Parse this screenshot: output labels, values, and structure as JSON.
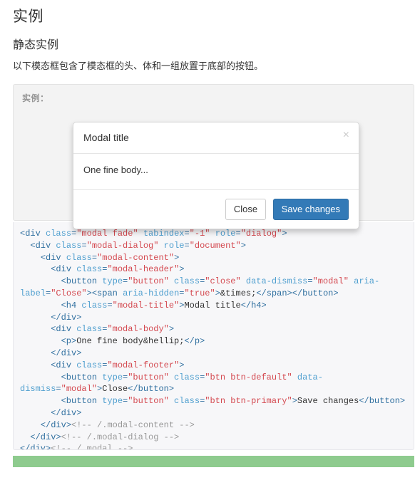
{
  "page": {
    "title": "实例",
    "section_heading": "静态实例",
    "description": "以下模态框包含了模态框的头、体和一组放置于底部的按钮。"
  },
  "example_box": {
    "label": "实例："
  },
  "modal": {
    "title": "Modal title",
    "close_icon": "×",
    "body_text": "One fine body...",
    "buttons": {
      "secondary": "Close",
      "primary": "Save changes"
    }
  },
  "code_block": {
    "language": "html",
    "lines": [
      [
        {
          "t": "tag",
          "s": "<div "
        },
        {
          "t": "attr",
          "s": "class"
        },
        {
          "t": "tag",
          "s": "="
        },
        {
          "t": "val",
          "s": "\"modal fade\""
        },
        {
          "t": "tag",
          "s": " "
        },
        {
          "t": "attr",
          "s": "tabindex"
        },
        {
          "t": "tag",
          "s": "="
        },
        {
          "t": "val",
          "s": "\"-1\""
        },
        {
          "t": "tag",
          "s": " "
        },
        {
          "t": "attr",
          "s": "role"
        },
        {
          "t": "tag",
          "s": "="
        },
        {
          "t": "val",
          "s": "\"dialog\""
        },
        {
          "t": "tag",
          "s": ">"
        }
      ],
      [
        {
          "t": "tag",
          "s": "  <div "
        },
        {
          "t": "attr",
          "s": "class"
        },
        {
          "t": "tag",
          "s": "="
        },
        {
          "t": "val",
          "s": "\"modal-dialog\""
        },
        {
          "t": "tag",
          "s": " "
        },
        {
          "t": "attr",
          "s": "role"
        },
        {
          "t": "tag",
          "s": "="
        },
        {
          "t": "val",
          "s": "\"document\""
        },
        {
          "t": "tag",
          "s": ">"
        }
      ],
      [
        {
          "t": "tag",
          "s": "    <div "
        },
        {
          "t": "attr",
          "s": "class"
        },
        {
          "t": "tag",
          "s": "="
        },
        {
          "t": "val",
          "s": "\"modal-content\""
        },
        {
          "t": "tag",
          "s": ">"
        }
      ],
      [
        {
          "t": "tag",
          "s": "      <div "
        },
        {
          "t": "attr",
          "s": "class"
        },
        {
          "t": "tag",
          "s": "="
        },
        {
          "t": "val",
          "s": "\"modal-header\""
        },
        {
          "t": "tag",
          "s": ">"
        }
      ],
      [
        {
          "t": "tag",
          "s": "        <button "
        },
        {
          "t": "attr",
          "s": "type"
        },
        {
          "t": "tag",
          "s": "="
        },
        {
          "t": "val",
          "s": "\"button\""
        },
        {
          "t": "tag",
          "s": " "
        },
        {
          "t": "attr",
          "s": "class"
        },
        {
          "t": "tag",
          "s": "="
        },
        {
          "t": "val",
          "s": "\"close\""
        },
        {
          "t": "tag",
          "s": " "
        },
        {
          "t": "attr",
          "s": "data-dismiss"
        },
        {
          "t": "tag",
          "s": "="
        },
        {
          "t": "val",
          "s": "\"modal\""
        },
        {
          "t": "tag",
          "s": " "
        },
        {
          "t": "attr",
          "s": "aria-label"
        },
        {
          "t": "tag",
          "s": "="
        },
        {
          "t": "val",
          "s": "\"Close\""
        },
        {
          "t": "tag",
          "s": "><span "
        },
        {
          "t": "attr",
          "s": "aria-hidden"
        },
        {
          "t": "tag",
          "s": "="
        },
        {
          "t": "val",
          "s": "\"true\""
        },
        {
          "t": "tag",
          "s": ">"
        },
        {
          "t": "ent",
          "s": "&times;"
        },
        {
          "t": "tag",
          "s": "</span></button>"
        }
      ],
      [
        {
          "t": "tag",
          "s": "        <h4 "
        },
        {
          "t": "attr",
          "s": "class"
        },
        {
          "t": "tag",
          "s": "="
        },
        {
          "t": "val",
          "s": "\"modal-title\""
        },
        {
          "t": "tag",
          "s": ">"
        },
        {
          "t": "text",
          "s": "Modal title"
        },
        {
          "t": "tag",
          "s": "</h4>"
        }
      ],
      [
        {
          "t": "tag",
          "s": "      </div>"
        }
      ],
      [
        {
          "t": "tag",
          "s": "      <div "
        },
        {
          "t": "attr",
          "s": "class"
        },
        {
          "t": "tag",
          "s": "="
        },
        {
          "t": "val",
          "s": "\"modal-body\""
        },
        {
          "t": "tag",
          "s": ">"
        }
      ],
      [
        {
          "t": "tag",
          "s": "        <p>"
        },
        {
          "t": "text",
          "s": "One fine body"
        },
        {
          "t": "ent",
          "s": "&hellip;"
        },
        {
          "t": "tag",
          "s": "</p>"
        }
      ],
      [
        {
          "t": "tag",
          "s": "      </div>"
        }
      ],
      [
        {
          "t": "tag",
          "s": "      <div "
        },
        {
          "t": "attr",
          "s": "class"
        },
        {
          "t": "tag",
          "s": "="
        },
        {
          "t": "val",
          "s": "\"modal-footer\""
        },
        {
          "t": "tag",
          "s": ">"
        }
      ],
      [
        {
          "t": "tag",
          "s": "        <button "
        },
        {
          "t": "attr",
          "s": "type"
        },
        {
          "t": "tag",
          "s": "="
        },
        {
          "t": "val",
          "s": "\"button\""
        },
        {
          "t": "tag",
          "s": " "
        },
        {
          "t": "attr",
          "s": "class"
        },
        {
          "t": "tag",
          "s": "="
        },
        {
          "t": "val",
          "s": "\"btn btn-default\""
        },
        {
          "t": "tag",
          "s": " "
        },
        {
          "t": "attr",
          "s": "data-dismiss"
        },
        {
          "t": "tag",
          "s": "="
        },
        {
          "t": "val",
          "s": "\"modal\""
        },
        {
          "t": "tag",
          "s": ">"
        },
        {
          "t": "text",
          "s": "Close"
        },
        {
          "t": "tag",
          "s": "</button>"
        }
      ],
      [
        {
          "t": "tag",
          "s": "        <button "
        },
        {
          "t": "attr",
          "s": "type"
        },
        {
          "t": "tag",
          "s": "="
        },
        {
          "t": "val",
          "s": "\"button\""
        },
        {
          "t": "tag",
          "s": " "
        },
        {
          "t": "attr",
          "s": "class"
        },
        {
          "t": "tag",
          "s": "="
        },
        {
          "t": "val",
          "s": "\"btn btn-primary\""
        },
        {
          "t": "tag",
          "s": ">"
        },
        {
          "t": "text",
          "s": "Save changes"
        },
        {
          "t": "tag",
          "s": "</button>"
        }
      ],
      [
        {
          "t": "tag",
          "s": "      </div>"
        }
      ],
      [
        {
          "t": "tag",
          "s": "    </div>"
        },
        {
          "t": "cmt",
          "s": "<!-- /.modal-content -->"
        }
      ],
      [
        {
          "t": "tag",
          "s": "  </div>"
        },
        {
          "t": "cmt",
          "s": "<!-- /.modal-dialog -->"
        }
      ],
      [
        {
          "t": "tag",
          "s": "</div>"
        },
        {
          "t": "cmt",
          "s": "<!-- /.modal -->"
        }
      ]
    ]
  },
  "colors": {
    "primary_button": "#337ab7",
    "example_bg": "#f3f3f3",
    "code_bg": "#f7f7f9",
    "green_bar": "#8ecb8e",
    "tag": "#2f6f9f",
    "attr": "#4f9fcf",
    "value": "#d44950",
    "comment": "#999999"
  }
}
